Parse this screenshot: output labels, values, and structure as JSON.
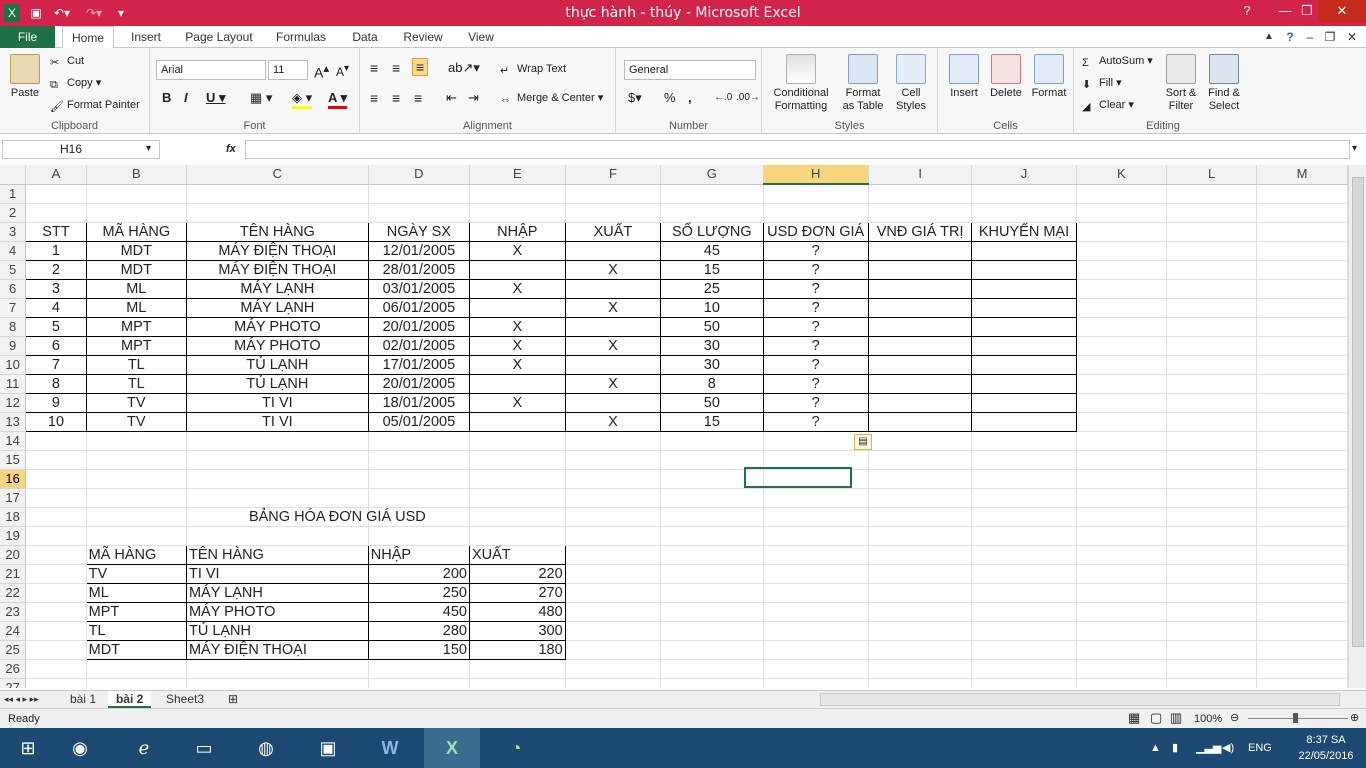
{
  "title": "thực hành - thúy  -  Microsoft Excel",
  "tabs": [
    "File",
    "Home",
    "Insert",
    "Page Layout",
    "Formulas",
    "Data",
    "Review",
    "View"
  ],
  "ribbon": {
    "clipboard": {
      "label": "Clipboard",
      "paste": "Paste",
      "cut": "Cut",
      "copy": "Copy",
      "format_painter": "Format Painter"
    },
    "font": {
      "label": "Font",
      "name": "Arial",
      "size": "11"
    },
    "alignment": {
      "label": "Alignment",
      "wrap": "Wrap Text",
      "merge": "Merge & Center"
    },
    "number": {
      "label": "Number",
      "format": "General"
    },
    "styles": {
      "label": "Styles",
      "conditional_1": "Conditional",
      "conditional_2": "Formatting",
      "format_table_1": "Format",
      "format_table_2": "as Table",
      "cell_styles_1": "Cell",
      "cell_styles_2": "Styles"
    },
    "cells": {
      "label": "Cells",
      "insert": "Insert",
      "delete": "Delete",
      "format": "Format"
    },
    "editing": {
      "label": "Editing",
      "autosum": "AutoSum",
      "fill": "Fill",
      "clear": "Clear",
      "sort_1": "Sort &",
      "sort_2": "Filter",
      "find_1": "Find &",
      "find_2": "Select"
    }
  },
  "formula_bar": {
    "name_box": "H16",
    "fx": "fx",
    "content": ""
  },
  "columns": [
    "A",
    "B",
    "C",
    "D",
    "E",
    "F",
    "G",
    "H",
    "I",
    "J",
    "K",
    "L",
    "M"
  ],
  "rows": [
    {
      "n": "1",
      "cells": [
        "",
        "",
        "",
        "",
        "",
        "",
        "",
        "",
        "",
        "",
        "",
        "",
        ""
      ]
    },
    {
      "n": "2",
      "cells": [
        "",
        "",
        "",
        "",
        "",
        "",
        "",
        "",
        "",
        "",
        "",
        "",
        ""
      ]
    },
    {
      "n": "3",
      "cells": [
        "STT",
        "MÃ HÀNG",
        "TÊN HÀNG",
        "NGÀY SX",
        "NHẬP",
        "XUẤT",
        "SỐ LƯỢNG",
        "USD ĐƠN GIÁ",
        "VNĐ GIÁ TRỊ",
        "KHUYẾN MẠI",
        "",
        "",
        ""
      ]
    },
    {
      "n": "4",
      "cells": [
        "1",
        "MDT",
        "MÁY ĐIỆN THOẠI",
        "12/01/2005",
        "X",
        "",
        "45",
        "?",
        "",
        "",
        "",
        "",
        ""
      ]
    },
    {
      "n": "5",
      "cells": [
        "2",
        "MDT",
        "MÁY ĐIỆN THOẠI",
        "28/01/2005",
        "",
        "X",
        "15",
        "?",
        "",
        "",
        "",
        "",
        ""
      ]
    },
    {
      "n": "6",
      "cells": [
        "3",
        "ML",
        "MÁY LẠNH",
        "03/01/2005",
        "X",
        "",
        "25",
        "?",
        "",
        "",
        "",
        "",
        ""
      ]
    },
    {
      "n": "7",
      "cells": [
        "4",
        "ML",
        "MÁY LẠNH",
        "06/01/2005",
        "",
        "X",
        "10",
        "?",
        "",
        "",
        "",
        "",
        ""
      ]
    },
    {
      "n": "8",
      "cells": [
        "5",
        "MPT",
        "MÁY PHOTO",
        "20/01/2005",
        "X",
        "",
        "50",
        "?",
        "",
        "",
        "",
        "",
        ""
      ]
    },
    {
      "n": "9",
      "cells": [
        "6",
        "MPT",
        "MÁY PHOTO",
        "02/01/2005",
        "X",
        "X",
        "30",
        "?",
        "",
        "",
        "",
        "",
        ""
      ]
    },
    {
      "n": "10",
      "cells": [
        "7",
        "TL",
        "TỦ LẠNH",
        "17/01/2005",
        "X",
        "",
        "30",
        "?",
        "",
        "",
        "",
        "",
        ""
      ]
    },
    {
      "n": "11",
      "cells": [
        "8",
        "TL",
        "TỦ LẠNH",
        "20/01/2005",
        "",
        "X",
        "8",
        "?",
        "",
        "",
        "",
        "",
        ""
      ]
    },
    {
      "n": "12",
      "cells": [
        "9",
        "TV",
        "TI VI",
        "18/01/2005",
        "X",
        "",
        "50",
        "?",
        "",
        "",
        "",
        "",
        ""
      ]
    },
    {
      "n": "13",
      "cells": [
        "10",
        "TV",
        "TI VI",
        "05/01/2005",
        "",
        "X",
        "15",
        "?",
        "",
        "",
        "",
        "",
        ""
      ]
    },
    {
      "n": "14",
      "cells": [
        "",
        "",
        "",
        "",
        "",
        "",
        "",
        "",
        "",
        "",
        "",
        "",
        ""
      ]
    },
    {
      "n": "15",
      "cells": [
        "",
        "",
        "",
        "",
        "",
        "",
        "",
        "",
        "",
        "",
        "",
        "",
        ""
      ]
    },
    {
      "n": "16",
      "cells": [
        "",
        "",
        "",
        "",
        "",
        "",
        "",
        "",
        "",
        "",
        "",
        "",
        ""
      ]
    },
    {
      "n": "17",
      "cells": [
        "",
        "",
        "",
        "",
        "",
        "",
        "",
        "",
        "",
        "",
        "",
        "",
        ""
      ]
    },
    {
      "n": "18",
      "cells": [
        "",
        "",
        "BẢNG HÓA ĐƠN GIÁ USD",
        "",
        "",
        "",
        "",
        "",
        "",
        "",
        "",
        "",
        ""
      ]
    },
    {
      "n": "19",
      "cells": [
        "",
        "",
        "",
        "",
        "",
        "",
        "",
        "",
        "",
        "",
        "",
        "",
        ""
      ]
    },
    {
      "n": "20",
      "cells": [
        "",
        "MÃ HÀNG",
        "TÊN HÀNG",
        "NHẬP",
        "XUẤT",
        "",
        "",
        "",
        "",
        "",
        "",
        "",
        ""
      ]
    },
    {
      "n": "21",
      "cells": [
        "",
        "TV",
        "TI VI",
        "200",
        "220",
        "",
        "",
        "",
        "",
        "",
        "",
        "",
        ""
      ]
    },
    {
      "n": "22",
      "cells": [
        "",
        "ML",
        "MÁY LẠNH",
        "250",
        "270",
        "",
        "",
        "",
        "",
        "",
        "",
        "",
        ""
      ]
    },
    {
      "n": "23",
      "cells": [
        "",
        "MPT",
        "MÁY PHOTO",
        "450",
        "480",
        "",
        "",
        "",
        "",
        "",
        "",
        "",
        ""
      ]
    },
    {
      "n": "24",
      "cells": [
        "",
        "TL",
        "TỦ LẠNH",
        "280",
        "300",
        "",
        "",
        "",
        "",
        "",
        "",
        "",
        ""
      ]
    },
    {
      "n": "25",
      "cells": [
        "",
        "MDT",
        "MÁY ĐIỆN THOẠI",
        "150",
        "180",
        "",
        "",
        "",
        "",
        "",
        "",
        "",
        ""
      ]
    },
    {
      "n": "26",
      "cells": [
        "",
        "",
        "",
        "",
        "",
        "",
        "",
        "",
        "",
        "",
        "",
        "",
        ""
      ]
    },
    {
      "n": "27",
      "cells": [
        "",
        "",
        "",
        "",
        "",
        "",
        "",
        "",
        "",
        "",
        "",
        "",
        ""
      ]
    }
  ],
  "sheet_tabs": [
    "bài 1",
    "bài 2",
    "Sheet3"
  ],
  "active_sheet": "bài 2",
  "status": {
    "ready": "Ready",
    "zoom": "100%"
  },
  "taskbar": {
    "lang": "ENG",
    "time": "8:37 SA",
    "date": "22/05/2016"
  },
  "colors": {
    "excel_green": "#217346",
    "title_bar": "#d2244b",
    "taskbar": "#1d4a72",
    "selection": "#f6d57d"
  }
}
